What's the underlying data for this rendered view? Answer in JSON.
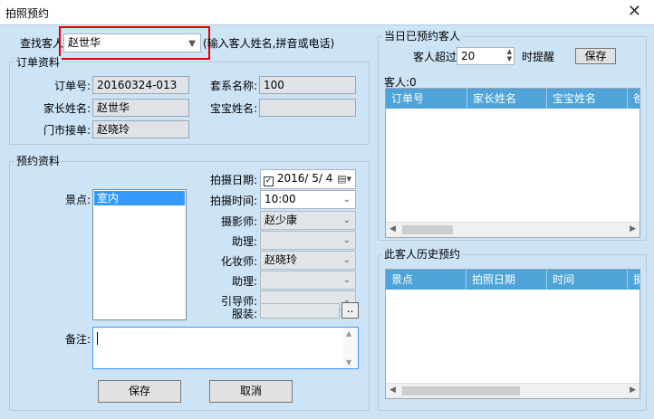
{
  "window": {
    "title": "拍照预约",
    "close": "✕"
  },
  "search": {
    "label": "查找客人:",
    "value": "赵世华",
    "hint": "(输入客人姓名,拼音或电话)"
  },
  "order": {
    "group_title": "订单资料",
    "order_no_label": "订单号:",
    "order_no": "20160324-013",
    "package_label": "套系名称:",
    "package": "100",
    "parent_label": "家长姓名:",
    "parent": "赵世华",
    "baby_label": "宝宝姓名:",
    "baby": "",
    "receiver_label": "门市接单:",
    "receiver": "赵晓玲"
  },
  "booking": {
    "group_title": "预约资料",
    "scene_label": "景点:",
    "scenes": [
      "室内"
    ],
    "date_label": "拍摄日期:",
    "date": "2016/  5/  4",
    "time_label": "拍摄时间:",
    "time": "10:00",
    "photographer_label": "摄影师:",
    "photographer": "赵少康",
    "assistant1_label": "助理:",
    "assistant1": "",
    "makeup_label": "化妆师:",
    "makeup": "赵晓玲",
    "assistant2_label": "助理:",
    "assistant2": "",
    "guide_label": "引导师:",
    "guide": "",
    "costume_label": "服装:",
    "costume": "",
    "costume_btn": "..",
    "note_label": "备注:",
    "note": "",
    "save": "保存",
    "cancel": "取消"
  },
  "today": {
    "group_title": "当日已预约客人",
    "over_label": "客人超过",
    "over_value": "20",
    "remind_label": "时提醒",
    "save": "保存",
    "count_label": "客人:0",
    "columns": [
      "订单号",
      "家长姓名",
      "宝宝姓名",
      "爸"
    ]
  },
  "history": {
    "group_title": "此客人历史预约",
    "columns": [
      "景点",
      "拍照日期",
      "时间",
      "摄"
    ]
  }
}
